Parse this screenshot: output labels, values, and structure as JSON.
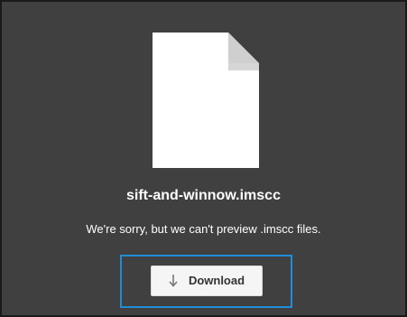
{
  "preview": {
    "file_name": "sift-and-winnow.imscc",
    "message": "We're sorry, but we can't preview .imscc files.",
    "file_icon": "generic-file-icon"
  },
  "download": {
    "label": "Download",
    "icon": "download-arrow-icon"
  },
  "colors": {
    "background": "#404040",
    "highlight": "#1e8fd6",
    "button_background": "#f5f5f5",
    "text": "#ffffff"
  }
}
